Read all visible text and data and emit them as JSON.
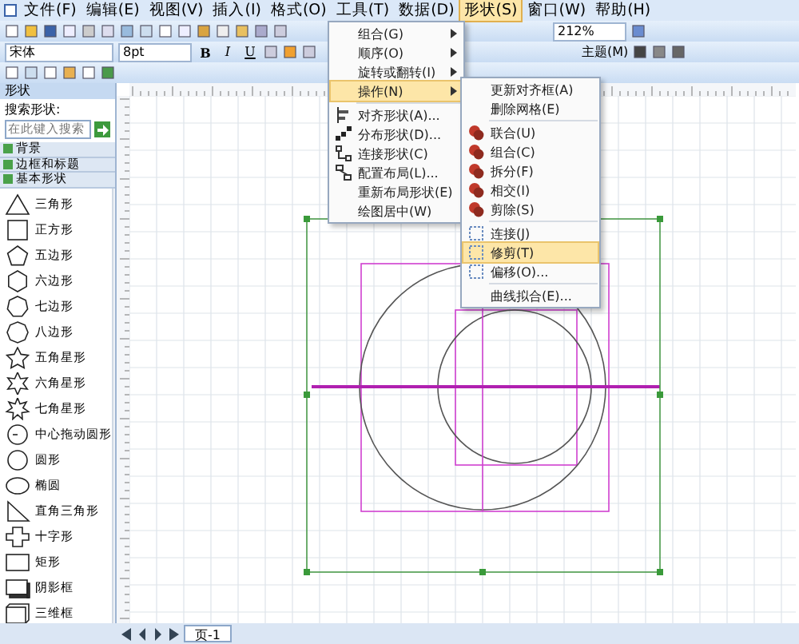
{
  "menu_bar": [
    {
      "label": "文件(F)",
      "selected": false
    },
    {
      "label": "编辑(E)",
      "selected": false
    },
    {
      "label": "视图(V)",
      "selected": false
    },
    {
      "label": "插入(I)",
      "selected": false
    },
    {
      "label": "格式(O)",
      "selected": false
    },
    {
      "label": "工具(T)",
      "selected": false
    },
    {
      "label": "数据(D)",
      "selected": false
    },
    {
      "label": "形状(S)",
      "selected": true
    },
    {
      "label": "窗口(W)",
      "selected": false
    },
    {
      "label": "帮助(H)",
      "selected": false
    }
  ],
  "toolbar": {
    "font": "宋体",
    "font_size": "8pt",
    "bold": "B",
    "italic": "I",
    "underline": "U",
    "zoom": "212%",
    "theme": "主题(M)"
  },
  "shape_menu": [
    {
      "label": "组合(G)",
      "kind": "submenu",
      "selected": false
    },
    {
      "label": "顺序(O)",
      "kind": "submenu",
      "selected": false
    },
    {
      "label": "旋转或翻转(I)",
      "kind": "submenu",
      "selected": false
    },
    {
      "label": "操作(N)",
      "kind": "submenu",
      "selected": true
    },
    {
      "label": "对齐形状(A)...",
      "kind": "align",
      "selected": false
    },
    {
      "label": "分布形状(D)...",
      "kind": "distribute",
      "selected": false
    },
    {
      "label": "连接形状(C)",
      "kind": "connect",
      "selected": false
    },
    {
      "label": "配置布局(L)...",
      "kind": "layout",
      "selected": false
    },
    {
      "label": "重新布局形状(E)",
      "kind": "plain",
      "selected": false
    },
    {
      "label": "绘图居中(W)",
      "kind": "plain",
      "selected": false
    }
  ],
  "operations_menu": [
    {
      "label": "更新对齐框(A)",
      "kind": "plain",
      "selected": false
    },
    {
      "label": "删除网格(E)",
      "kind": "plain",
      "selected": false
    },
    {
      "label": "联合(U)",
      "kind": "boolean",
      "selected": false
    },
    {
      "label": "组合(C)",
      "kind": "boolean",
      "selected": false
    },
    {
      "label": "拆分(F)",
      "kind": "boolean",
      "selected": false
    },
    {
      "label": "相交(I)",
      "kind": "boolean",
      "selected": false
    },
    {
      "label": "剪除(S)",
      "kind": "boolean",
      "selected": false
    },
    {
      "label": "连接(J)",
      "kind": "path",
      "selected": false
    },
    {
      "label": "修剪(T)",
      "kind": "path",
      "selected": true
    },
    {
      "label": "偏移(O)...",
      "kind": "path",
      "selected": false
    },
    {
      "label": "曲线拟合(E)...",
      "kind": "plain",
      "selected": false
    }
  ],
  "shapes_panel": {
    "title": "形状",
    "search_label": "搜索形状:",
    "search_placeholder": "在此键入搜索",
    "stencils": [
      "背景",
      "边框和标题",
      "基本形状"
    ],
    "shapes": [
      {
        "label": "三角形",
        "kind": "triangle"
      },
      {
        "label": "正方形",
        "kind": "square"
      },
      {
        "label": "五边形",
        "kind": "pentagon"
      },
      {
        "label": "六边形",
        "kind": "hexagon"
      },
      {
        "label": "七边形",
        "kind": "heptagon"
      },
      {
        "label": "八边形",
        "kind": "octagon"
      },
      {
        "label": "五角星形",
        "kind": "star5"
      },
      {
        "label": "六角星形",
        "kind": "star6"
      },
      {
        "label": "七角星形",
        "kind": "star7"
      },
      {
        "label": "中心拖动圆形",
        "kind": "center-circle"
      },
      {
        "label": "圆形",
        "kind": "circle"
      },
      {
        "label": "椭圆",
        "kind": "ellipse"
      },
      {
        "label": "直角三角形",
        "kind": "right-triangle"
      },
      {
        "label": "十字形",
        "kind": "cross"
      },
      {
        "label": "矩形",
        "kind": "rectangle"
      },
      {
        "label": "阴影框",
        "kind": "shadow-box"
      },
      {
        "label": "三维框",
        "kind": "box3d"
      }
    ]
  },
  "page_tabs": [
    {
      "label": "页-1",
      "selected": true
    }
  ]
}
